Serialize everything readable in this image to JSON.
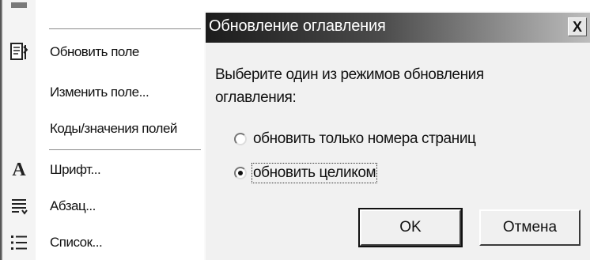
{
  "context_menu": {
    "items": [
      {
        "label": "",
        "icon": "blank-icon",
        "faded": true
      },
      {
        "label": "Обновить поле",
        "icon": "update-field-icon"
      },
      {
        "label": "Изменить поле...",
        "icon": ""
      },
      {
        "label": "Коды/значения полей",
        "icon": ""
      },
      {
        "label": "Шрифт...",
        "icon": "font-icon"
      },
      {
        "label": "Абзац...",
        "icon": "paragraph-icon"
      },
      {
        "label": "Список...",
        "icon": "list-icon"
      }
    ]
  },
  "dialog": {
    "title": "Обновление оглавления",
    "close_label": "X",
    "prompt": "Выберите один из режимов обновления оглавления:",
    "options": [
      {
        "label": "обновить только номера страниц",
        "checked": false
      },
      {
        "label": "обновить целиком",
        "checked": true
      }
    ],
    "ok_label": "OK",
    "cancel_label": "Отмена"
  }
}
